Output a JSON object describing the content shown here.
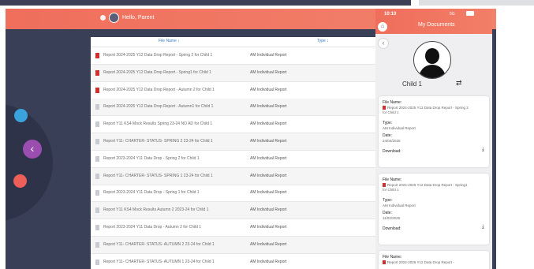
{
  "header": {
    "greeting": "Hello, Parent"
  },
  "table": {
    "col_file": "File Name ↕",
    "col_type": "Type ↕",
    "rows": [
      {
        "name": "Report 2024-2025 Y12 Data Drop Report - Spring 2 for Child 1",
        "type": "AM Individual Report",
        "icon": "red"
      },
      {
        "name": "Report 2024-2025 Y12 Data Drop Report - Spring1 for Child 1",
        "type": "AM Individual Report",
        "icon": "red"
      },
      {
        "name": "Report 2024-2025 Y12 Data Drop Report - Autumn 2 for Child 1",
        "type": "AM Individual Report",
        "icon": "red"
      },
      {
        "name": "Report 2024-2025 Y12 Data Drop Report - Autumn1 for Child 1",
        "type": "AM Individual Report",
        "icon": "grey"
      },
      {
        "name": "Report Y11 KS4 Mock Results Spring 23-24 NO AD for Child 1",
        "type": "AM Individual Report",
        "icon": "grey"
      },
      {
        "name": "Report Y11- CHARTER- STATUS- SPRING 2 23-24 for Child 1",
        "type": "AM Individual Report",
        "icon": "grey"
      },
      {
        "name": "Report 2023-2024 Y11 Data Drop - Spring 2 for Child 1",
        "type": "AM Individual Report",
        "icon": "grey"
      },
      {
        "name": "Report Y11- CHARTER- STATUS- SPRING 1 23-24 for Child 1",
        "type": "AM Individual Report",
        "icon": "grey"
      },
      {
        "name": "Report 2023-2024 Y11 Data Drop - Spring 1 for Child 1",
        "type": "AM Individual Report",
        "icon": "grey"
      },
      {
        "name": "Report Y11 KS4 Mock Results Autumn 2 2023-24 for Child 1",
        "type": "AM Individual Report",
        "icon": "grey"
      },
      {
        "name": "Report 2023-2024 Y11 Data Drop - Autumn 2 for Child 1",
        "type": "AM Individual Report",
        "icon": "grey"
      },
      {
        "name": "Report Y11- CHARTER- STATUS- AUTUMN 2 23-24 for Child 1",
        "type": "AM Individual Report",
        "icon": "grey"
      },
      {
        "name": "Report Y11- CHARTER- STATUS- AUTUMN 1 23-24 for Child 1",
        "type": "AM Individual Report",
        "icon": "grey"
      }
    ]
  },
  "phone": {
    "time": "10:10",
    "status": "5G",
    "title": "My Documents",
    "child": "Child 1",
    "labels": {
      "file": "File Name:",
      "type": "Type:",
      "date": "Date:",
      "download": "Download:"
    },
    "cards": [
      {
        "file": "Report 2024-2025 Y12 Data Drop Report - Spring 2 for Child 1",
        "type": "AM Individual Report",
        "date": "24/04/2025"
      },
      {
        "file": "Report 2024-2025 Y12 Data Drop Report - Spring1 for Child 1",
        "type": "AM Individual Report",
        "date": "11/02/2025"
      },
      {
        "file": "Report 2024-2025 Y12 Data Drop Report -",
        "type": "",
        "date": ""
      }
    ]
  }
}
